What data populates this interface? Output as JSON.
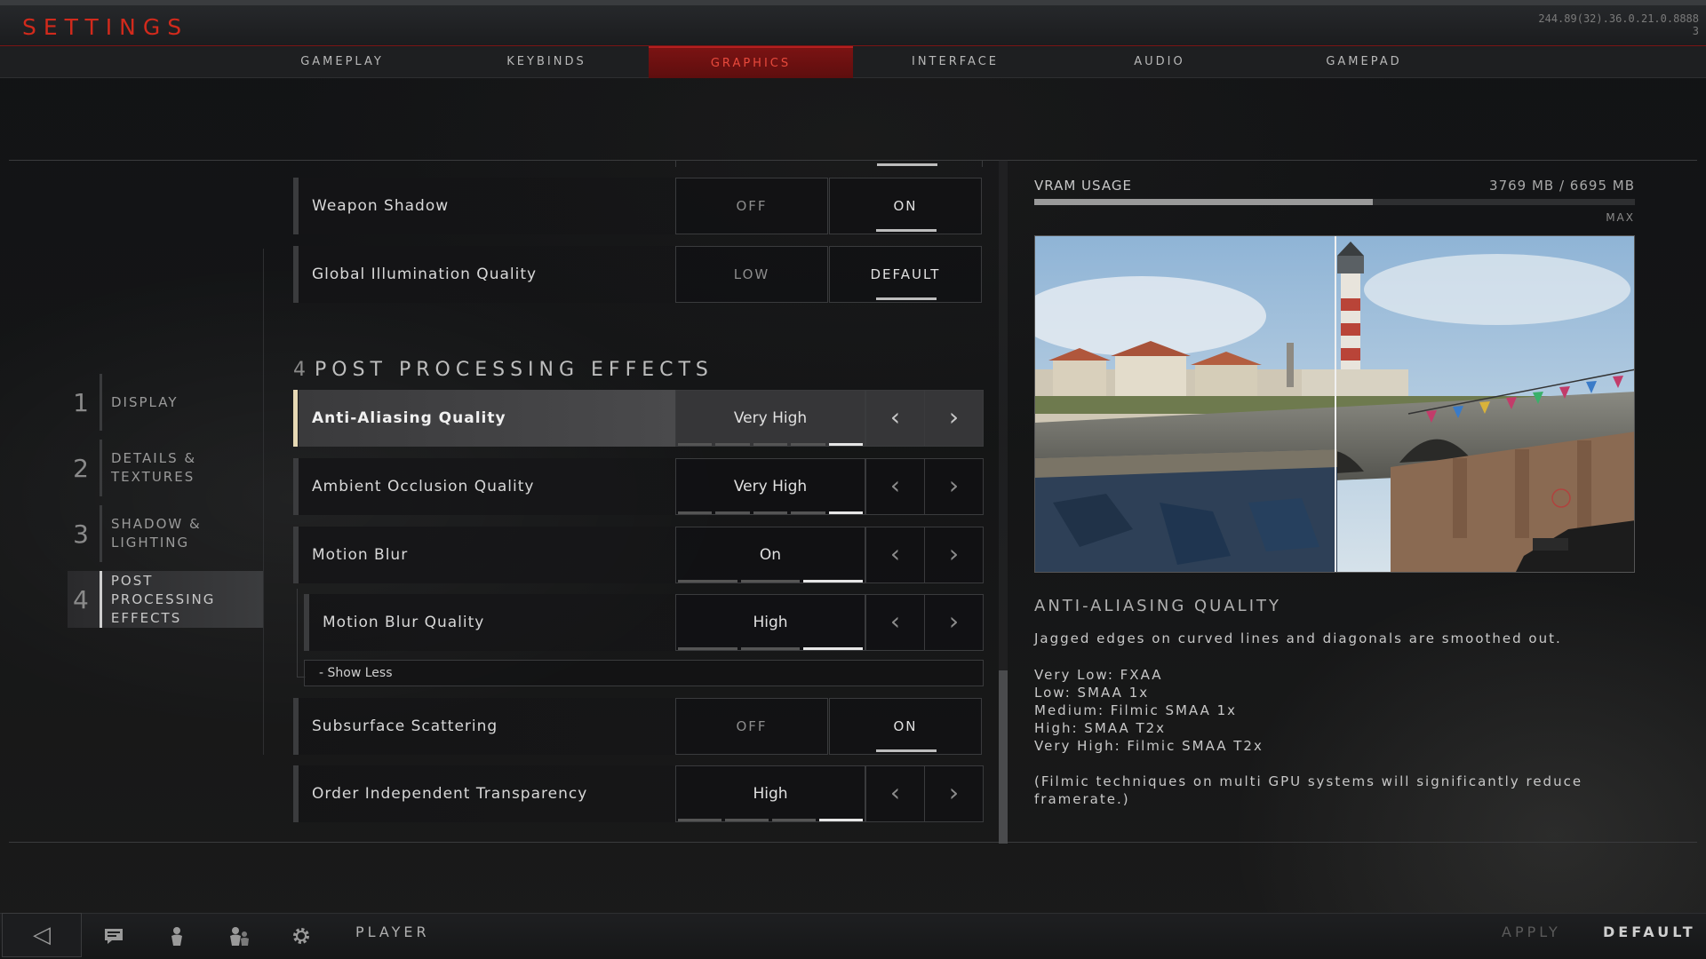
{
  "header": {
    "title": "SETTINGS",
    "build_line1": "244.89(32).36.0.21.0.8888",
    "build_line2": "3"
  },
  "tabs": [
    {
      "label": "GAMEPLAY",
      "active": false
    },
    {
      "label": "KEYBINDS",
      "active": false
    },
    {
      "label": "GRAPHICS",
      "active": true
    },
    {
      "label": "INTERFACE",
      "active": false
    },
    {
      "label": "AUDIO",
      "active": false
    },
    {
      "label": "GAMEPAD",
      "active": false
    }
  ],
  "nav": [
    {
      "num": "1",
      "label": "DISPLAY",
      "active": false
    },
    {
      "num": "2",
      "label": "DETAILS &\nTEXTURES",
      "active": false
    },
    {
      "num": "3",
      "label": "SHADOW &\nLIGHTING",
      "active": false
    },
    {
      "num": "4",
      "label": "POST PROCESSING\nEFFECTS",
      "active": true
    }
  ],
  "settings": {
    "weapon_shadow": {
      "label": "Weapon Shadow",
      "off": "OFF",
      "on": "ON",
      "value": "ON"
    },
    "gi_quality": {
      "label": "Global Illumination Quality",
      "low": "LOW",
      "default": "DEFAULT",
      "value": "DEFAULT"
    },
    "section": {
      "num": "4",
      "title": "POST PROCESSING EFFECTS"
    },
    "aa_quality": {
      "label": "Anti-Aliasing Quality",
      "value": "Very High",
      "level": 5,
      "levels": 5
    },
    "ao_quality": {
      "label": "Ambient Occlusion Quality",
      "value": "Very High",
      "level": 5,
      "levels": 5
    },
    "motion_blur": {
      "label": "Motion Blur",
      "value": "On",
      "level": 3,
      "levels": 3
    },
    "motion_blur_quality": {
      "label": "Motion Blur Quality",
      "value": "High",
      "level": 3,
      "levels": 3
    },
    "show_less": "- Show Less",
    "subsurface": {
      "label": "Subsurface Scattering",
      "off": "OFF",
      "on": "ON",
      "value": "ON"
    },
    "oit": {
      "label": "Order Independent Transparency",
      "value": "High",
      "level": 4,
      "levels": 4
    }
  },
  "vram": {
    "label": "VRAM USAGE",
    "value": "3769 MB / 6695 MB",
    "used_mb": 3769,
    "total_mb": 6695,
    "max_label": "MAX"
  },
  "info": {
    "title": "ANTI-ALIASING QUALITY",
    "description": "Jagged edges on curved lines and diagonals are smoothed out.",
    "list": [
      "Very Low: FXAA",
      "Low: SMAA 1x",
      "Medium: Filmic SMAA 1x",
      "High: SMAA T2x",
      "Very High: Filmic SMAA T2x"
    ],
    "note": "(Filmic techniques on multi GPU systems will significantly reduce framerate.)"
  },
  "footer": {
    "player_label": "PLAYER",
    "apply_label": "APPLY",
    "default_label": "DEFAULT",
    "icons": [
      "back-arrow-icon",
      "chat-icon",
      "player-icon",
      "party-icon",
      "gear-icon"
    ]
  }
}
